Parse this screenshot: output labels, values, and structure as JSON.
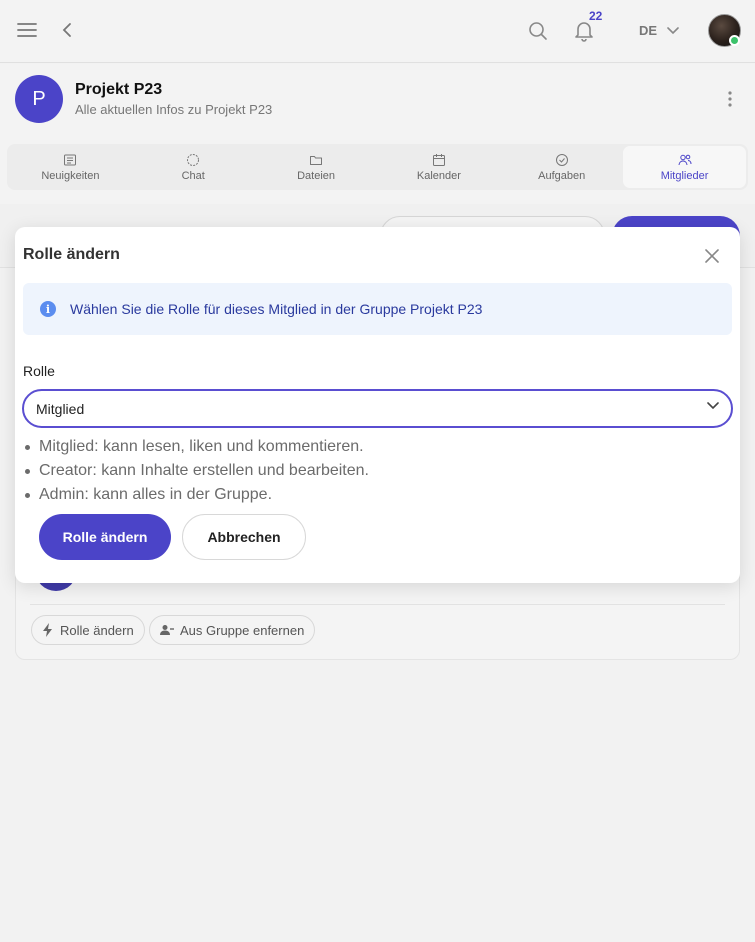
{
  "header": {
    "notification_count": "22",
    "language": "DE"
  },
  "group": {
    "avatar_letter": "P",
    "title": "Projekt P23",
    "subtitle": "Alle aktuellen Infos zu Projekt P23"
  },
  "tabs": [
    {
      "label": "Neuigkeiten",
      "icon": "newspaper-icon"
    },
    {
      "label": "Chat",
      "icon": "chat-icon"
    },
    {
      "label": "Dateien",
      "icon": "folder-icon"
    },
    {
      "label": "Kalender",
      "icon": "calendar-icon"
    },
    {
      "label": "Aufgaben",
      "icon": "task-check-icon"
    },
    {
      "label": "Mitglieder",
      "icon": "members-icon",
      "active": true
    }
  ],
  "background_card": {
    "role_chip": "Rolle ändern",
    "remove_chip": "Aus Gruppe enfernen"
  },
  "modal": {
    "title": "Rolle ändern",
    "info": "Wählen Sie die Rolle für dieses Mitglied in der Gruppe Projekt P23",
    "role_label": "Rolle",
    "role_value": "Mitglied",
    "role_descriptions": [
      "Mitglied: kann lesen, liken und kommentieren.",
      "Creator: kann Inhalte erstellen und bearbeiten.",
      "Admin: kann alles in der Gruppe."
    ],
    "confirm_label": "Rolle ändern",
    "cancel_label": "Abbrechen"
  },
  "colors": {
    "accent": "#4b44c8",
    "info_bg": "#eef4fd",
    "info_text": "#2a3a9e",
    "online": "#3cc26b"
  }
}
